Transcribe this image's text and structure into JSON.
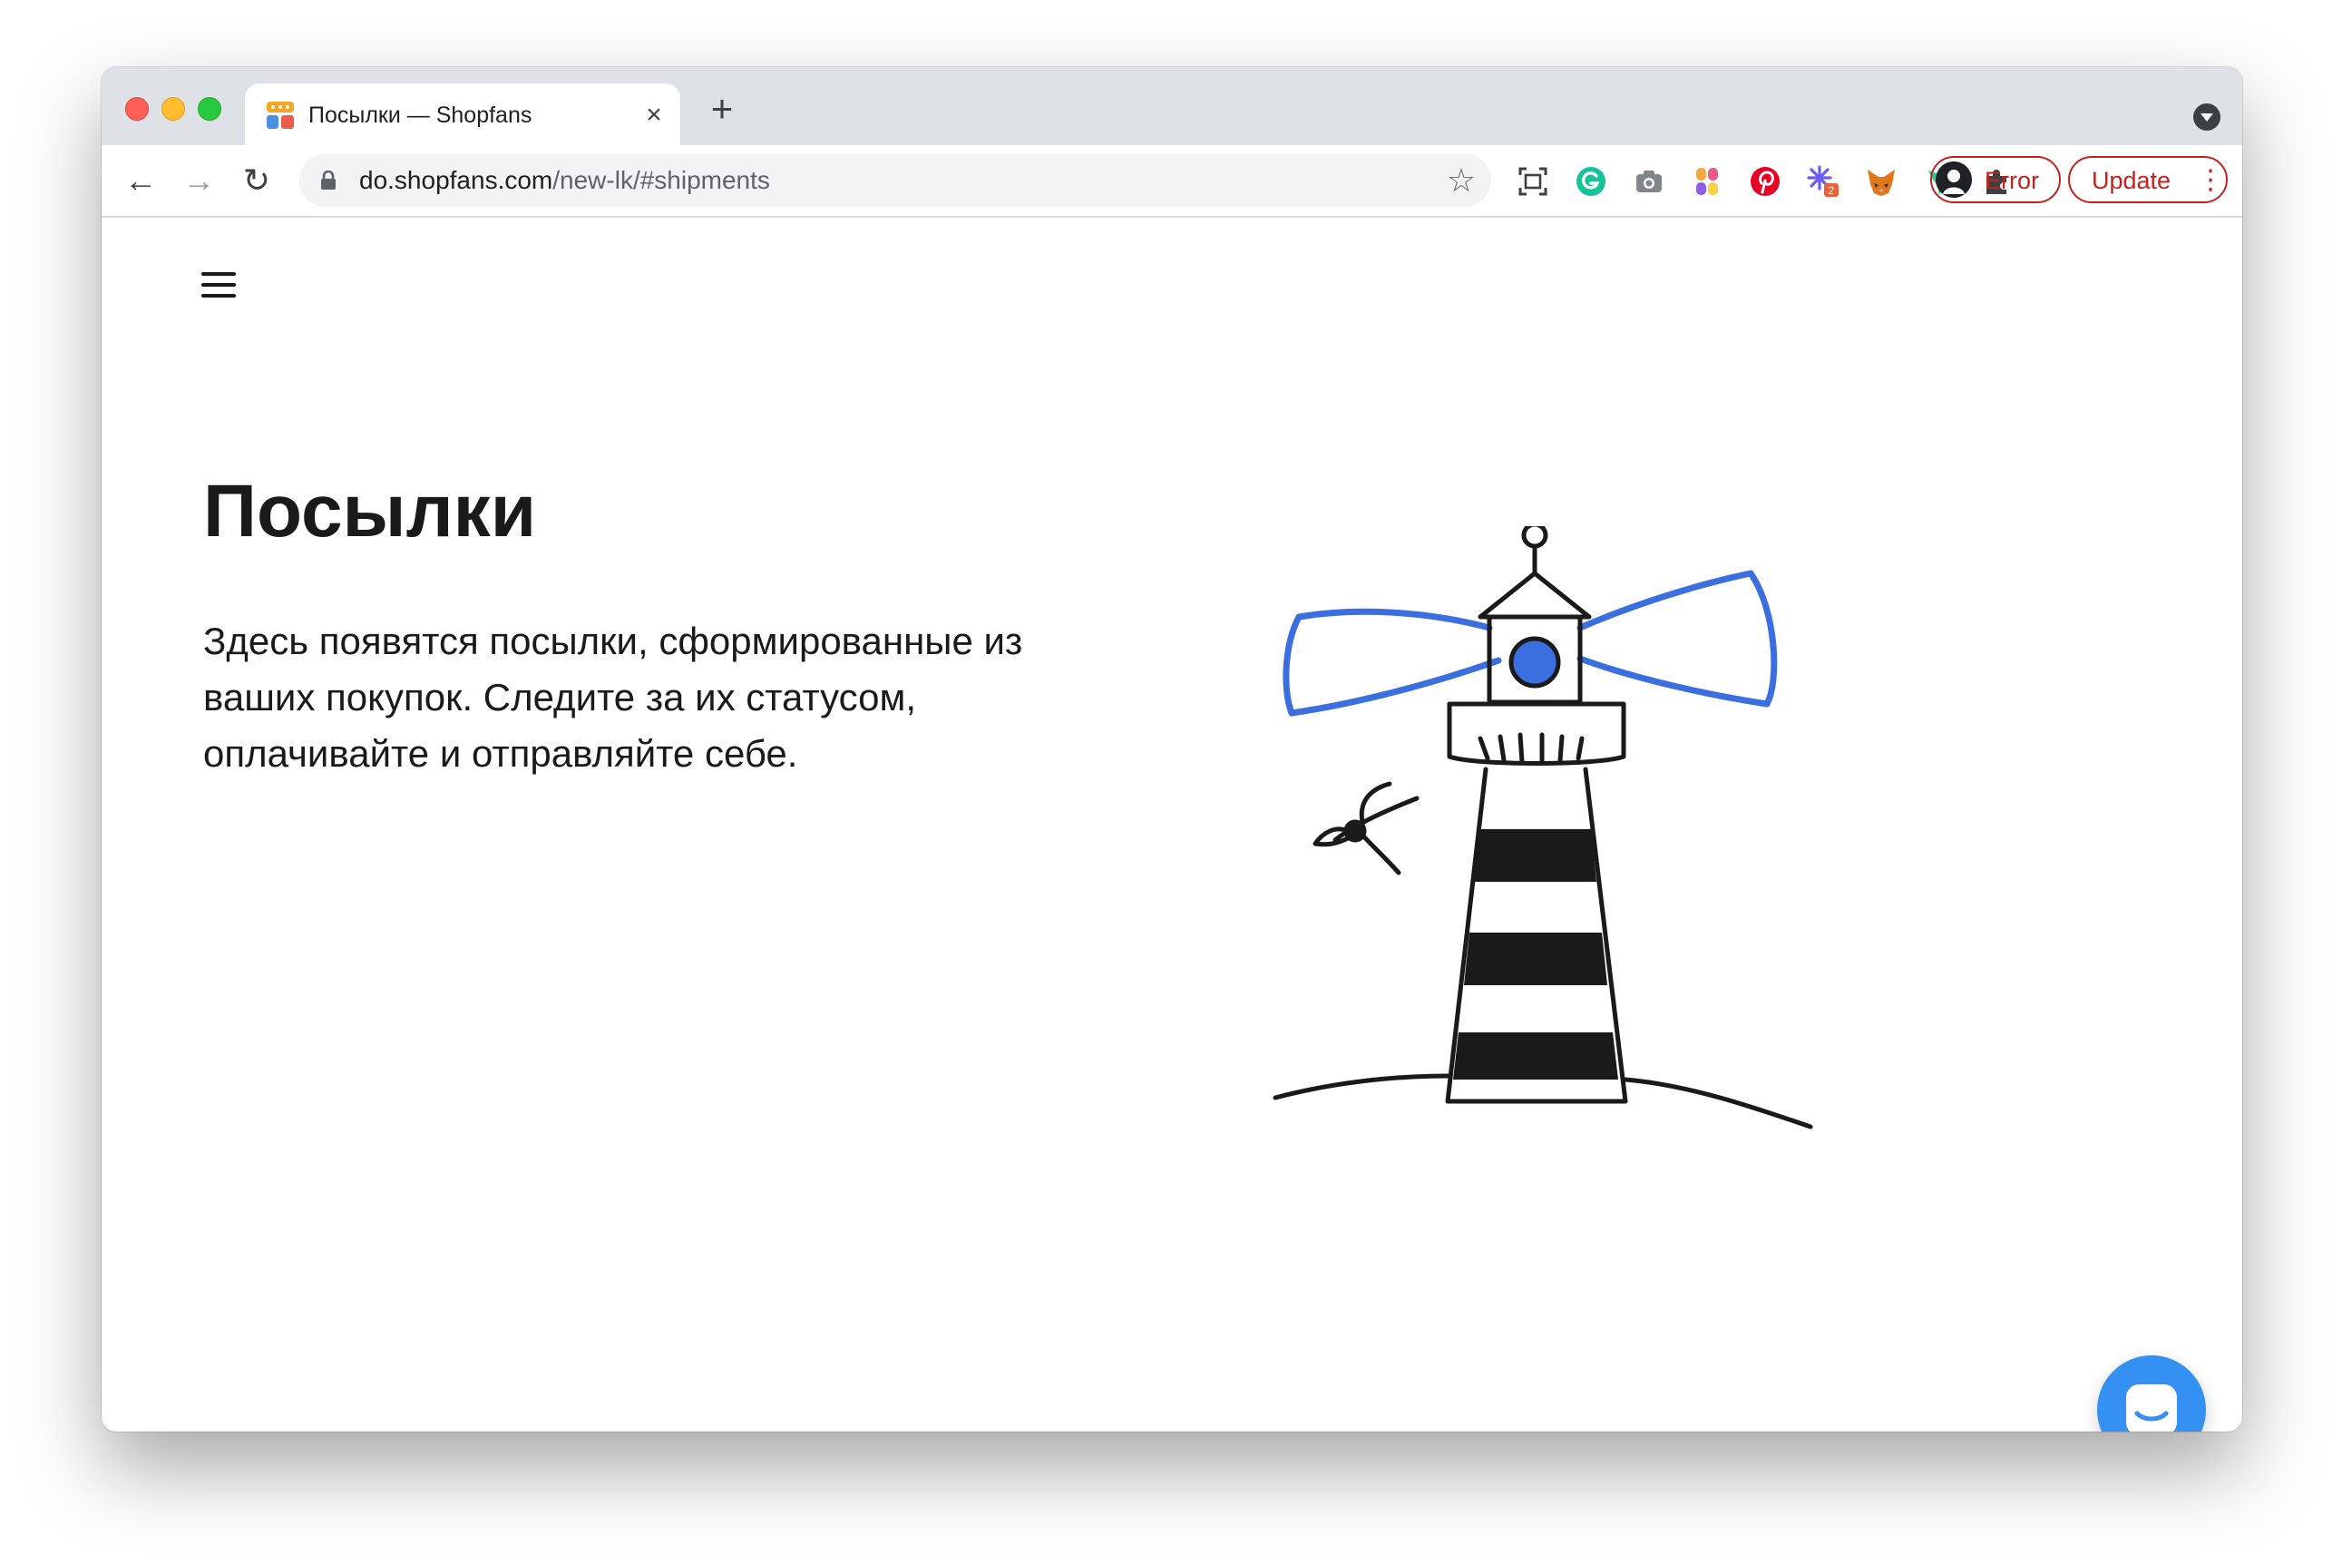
{
  "browser": {
    "tab": {
      "title": "Посылки — Shopfans",
      "close_glyph": "×"
    },
    "new_tab_glyph": "+",
    "nav": {
      "back_glyph": "←",
      "forward_glyph": "→",
      "reload_glyph": "↻"
    },
    "address": {
      "host": "do.shopfans.com",
      "path": "/new-lk/#shipments"
    },
    "bookmark_glyph": "☆",
    "extensions": [
      {
        "name": "screenshot-frame-icon"
      },
      {
        "name": "grammarly-icon"
      },
      {
        "name": "camera-icon"
      },
      {
        "name": "color-palette-icon"
      },
      {
        "name": "pinterest-icon"
      },
      {
        "name": "sparkle-extension-icon",
        "badge": "2"
      },
      {
        "name": "metamask-fox-icon"
      },
      {
        "name": "bird-extension-icon"
      },
      {
        "name": "puzzle-piece-icon"
      }
    ],
    "profile": {
      "label": "Error"
    },
    "update": {
      "label": "Update",
      "menu_glyph": "⋮"
    }
  },
  "page": {
    "title": "Посылки",
    "description": "Здесь появятся посылки, сформированные из ваших покупок. Следите за их статусом, оплачивайте и отправляйте себе."
  },
  "colors": {
    "accent_blue": "#3590f3",
    "beam_blue": "#3b6fe0",
    "error_red": "#c5221f",
    "tab_strip": "#dee1e6"
  }
}
